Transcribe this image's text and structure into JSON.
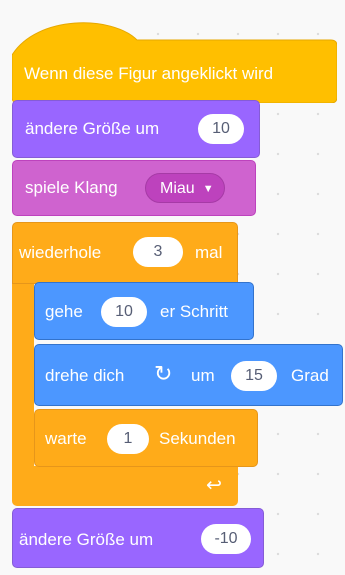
{
  "event_block": {
    "label": "Wenn diese Figur angeklickt wird"
  },
  "size_block_1": {
    "label": "ändere Größe um",
    "value": "10"
  },
  "sound_block": {
    "label": "spiele Klang",
    "sound": "Miau"
  },
  "repeat_block": {
    "label": "wiederhole",
    "value": "3",
    "suffix": "mal"
  },
  "move_block": {
    "label": "gehe",
    "value": "10",
    "suffix": "er Schritt"
  },
  "turn_block": {
    "label": "drehe dich",
    "middle": "um",
    "value": "15",
    "suffix": "Grad"
  },
  "wait_block": {
    "label": "warte",
    "value": "1",
    "suffix": "Sekunden"
  },
  "size_block_2": {
    "label": "ändere Größe um",
    "value": "-10"
  },
  "colors": {
    "events": "#ffbf00",
    "looks": "#9966ff",
    "sound": "#cf63cf",
    "control": "#ffab19",
    "motion": "#4c97ff"
  },
  "icons": {
    "turn": "rotate-clockwise-icon",
    "loop_end": "loop-arrow-icon",
    "dropdown": "caret-down-icon"
  }
}
